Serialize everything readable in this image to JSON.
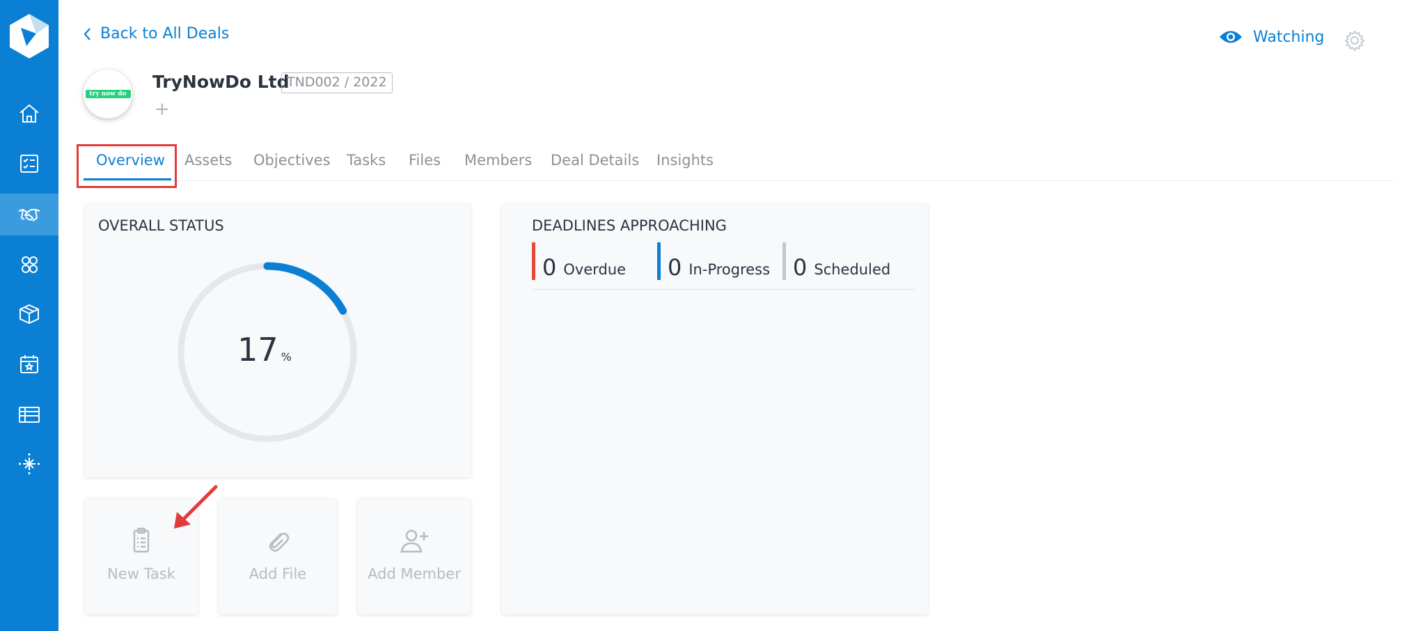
{
  "header": {
    "back_label": "Back to All Deals",
    "watching_label": "Watching",
    "company_name": "TryNowDo Ltd",
    "company_logo_text": "try now do",
    "deal_code": "TND002 / 2022",
    "add_tag_symbol": "+"
  },
  "sidebar": {
    "items": [
      {
        "icon": "home-icon"
      },
      {
        "icon": "checklist-icon"
      },
      {
        "icon": "handshake-icon",
        "active": true
      },
      {
        "icon": "contacts-icon"
      },
      {
        "icon": "box-icon"
      },
      {
        "icon": "calendar-star-icon"
      },
      {
        "icon": "table-icon"
      },
      {
        "icon": "sparkle-grid-icon"
      }
    ]
  },
  "tabs": [
    {
      "label": "Overview",
      "active": true
    },
    {
      "label": "Assets"
    },
    {
      "label": "Objectives"
    },
    {
      "label": "Tasks"
    },
    {
      "label": "Files"
    },
    {
      "label": "Members"
    },
    {
      "label": "Deal Details"
    },
    {
      "label": "Insights"
    }
  ],
  "overall_status": {
    "title": "OVERALL STATUS",
    "value": 17,
    "value_text": "17",
    "unit": "%"
  },
  "deadlines": {
    "title": "DEADLINES APPROACHING",
    "items": [
      {
        "count": "0",
        "label": "Overdue",
        "color": "#e5493a"
      },
      {
        "count": "0",
        "label": "In-Progress",
        "color": "#0a7fd3"
      },
      {
        "count": "0",
        "label": "Scheduled",
        "color": "#c4c8cd"
      }
    ]
  },
  "actions": [
    {
      "label": "New Task",
      "icon": "clipboard-icon"
    },
    {
      "label": "Add File",
      "icon": "paperclip-icon"
    },
    {
      "label": "Add Member",
      "icon": "add-user-icon"
    }
  ],
  "colors": {
    "brand": "#0a7fd3",
    "sidebar_active": "#3b9bdf",
    "highlight": "#e23b3b",
    "gauge_track": "#e6e7e9"
  }
}
